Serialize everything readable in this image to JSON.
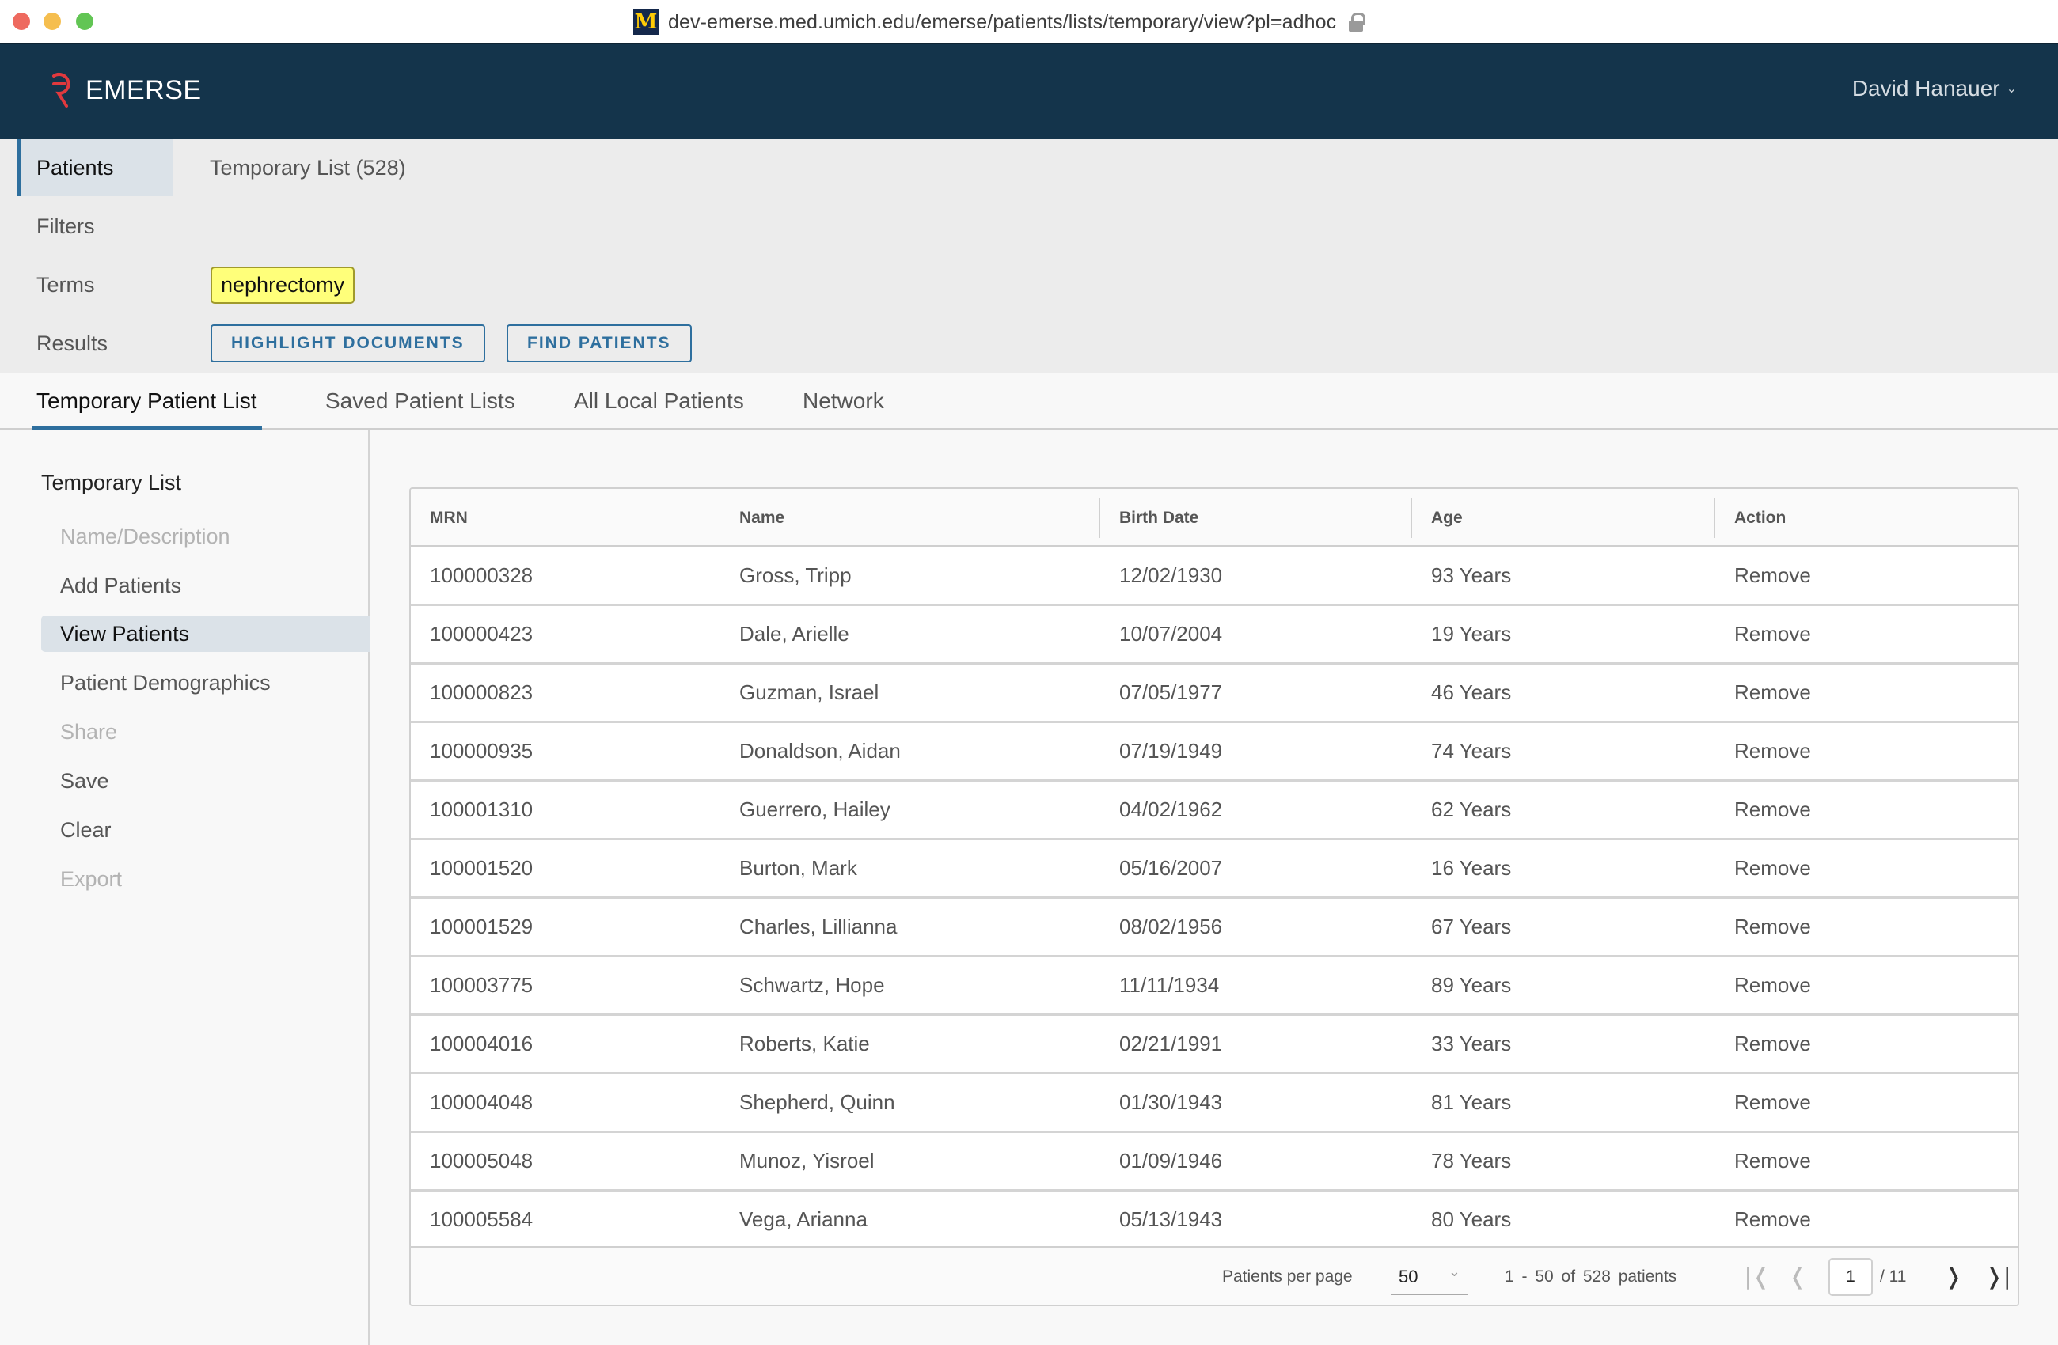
{
  "browser": {
    "url": "dev-emerse.med.umich.edu/emerse/patients/lists/temporary/view?pl=adhoc",
    "site_icon": "umich-block-m-icon",
    "secure_icon": "lock-icon"
  },
  "header": {
    "brand": "EMERSE",
    "user_name": "David Hanauer",
    "user_chevron": "⌄"
  },
  "summary": {
    "patients_label": "Patients",
    "patients_value": "Temporary List (528)",
    "filters_label": "Filters",
    "terms_label": "Terms",
    "terms": [
      "nephrectomy"
    ],
    "results_label": "Results",
    "highlight_button": "HIGHLIGHT DOCUMENTS",
    "find_button": "FIND PATIENTS"
  },
  "tabs": [
    {
      "label": "Temporary Patient List",
      "active": true
    },
    {
      "label": "Saved Patient Lists",
      "active": false
    },
    {
      "label": "All Local Patients",
      "active": false
    },
    {
      "label": "Network",
      "active": false
    }
  ],
  "sidebar": {
    "title": "Temporary List",
    "items": [
      {
        "label": "Name/Description",
        "state": "disabled"
      },
      {
        "label": "Add Patients",
        "state": "normal"
      },
      {
        "label": "View Patients",
        "state": "active"
      },
      {
        "label": "Patient Demographics",
        "state": "normal"
      },
      {
        "label": "Share",
        "state": "disabled"
      },
      {
        "label": "Save",
        "state": "normal"
      },
      {
        "label": "Clear",
        "state": "normal"
      },
      {
        "label": "Export",
        "state": "disabled"
      }
    ]
  },
  "table": {
    "columns": [
      "MRN",
      "Name",
      "Birth Date",
      "Age",
      "Action"
    ],
    "rows": [
      [
        "100000328",
        "Gross, Tripp",
        "12/02/1930",
        "93 Years",
        "Remove"
      ],
      [
        "100000423",
        "Dale, Arielle",
        "10/07/2004",
        "19 Years",
        "Remove"
      ],
      [
        "100000823",
        "Guzman, Israel",
        "07/05/1977",
        "46 Years",
        "Remove"
      ],
      [
        "100000935",
        "Donaldson, Aidan",
        "07/19/1949",
        "74 Years",
        "Remove"
      ],
      [
        "100001310",
        "Guerrero, Hailey",
        "04/02/1962",
        "62 Years",
        "Remove"
      ],
      [
        "100001520",
        "Burton, Mark",
        "05/16/2007",
        "16 Years",
        "Remove"
      ],
      [
        "100001529",
        "Charles, Lillianna",
        "08/02/1956",
        "67 Years",
        "Remove"
      ],
      [
        "100003775",
        "Schwartz, Hope",
        "11/11/1934",
        "89 Years",
        "Remove"
      ],
      [
        "100004016",
        "Roberts, Katie",
        "02/21/1991",
        "33 Years",
        "Remove"
      ],
      [
        "100004048",
        "Shepherd, Quinn",
        "01/30/1943",
        "81 Years",
        "Remove"
      ],
      [
        "100005048",
        "Munoz, Yisroel",
        "01/09/1946",
        "78 Years",
        "Remove"
      ],
      [
        "100005584",
        "Vega, Arianna",
        "05/13/1943",
        "80 Years",
        "Remove"
      ]
    ]
  },
  "pagination": {
    "per_page_label": "Patients per page",
    "per_page_value": "50",
    "range_text": "1 - 50  of  528 patients",
    "current_page": "1",
    "total_pages_text": "/ 11",
    "first_icon": "|❬",
    "prev_icon": "❬",
    "next_icon": "❭",
    "last_icon": "❭|"
  },
  "colors": {
    "header_bg": "#14344b",
    "accent": "#2e6f9e",
    "term_highlight": "#ffff7a",
    "brand_mark": "#e0393e"
  }
}
